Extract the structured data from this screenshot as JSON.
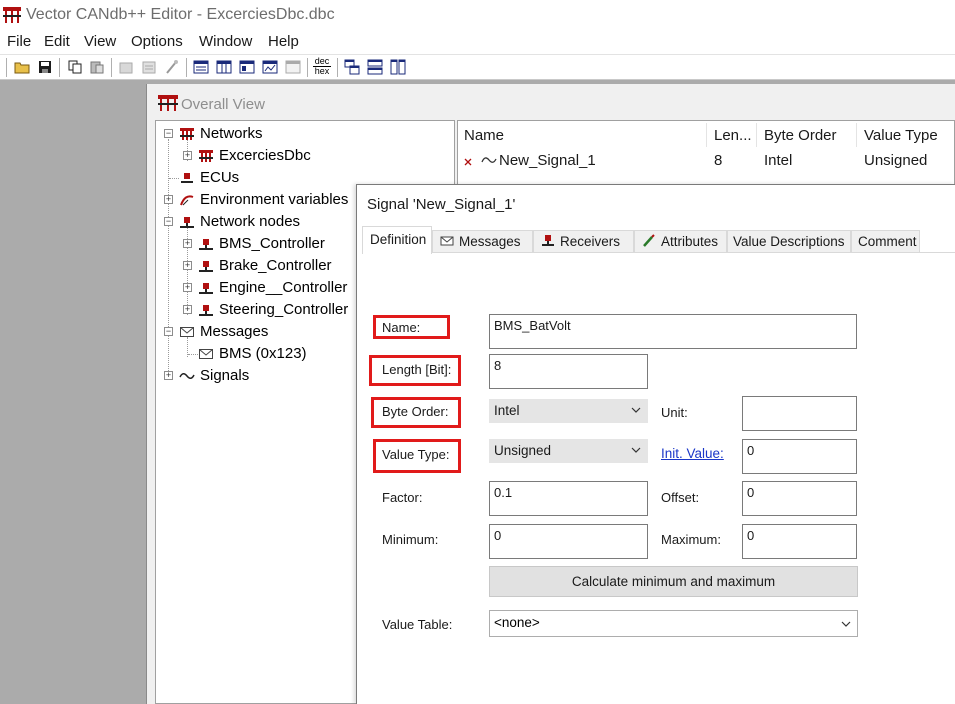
{
  "app": {
    "title": "Vector CANdb++ Editor - ExcerciesDbc.dbc"
  },
  "menu": [
    "File",
    "Edit",
    "View",
    "Options",
    "Window",
    "Help"
  ],
  "toolbar": {
    "dec_hex_top": "dec",
    "dec_hex_bottom": "hex"
  },
  "overall_view": {
    "title": "Overall View",
    "tree": [
      {
        "label": "Networks"
      },
      {
        "label": "ExcerciesDbc"
      },
      {
        "label": "ECUs"
      },
      {
        "label": "Environment variables"
      },
      {
        "label": "Network nodes"
      },
      {
        "label": "BMS_Controller"
      },
      {
        "label": "Brake_Controller"
      },
      {
        "label": "Engine__Controller"
      },
      {
        "label": "Steering_Controller"
      },
      {
        "label": "Messages"
      },
      {
        "label": "BMS (0x123)"
      },
      {
        "label": "Signals"
      }
    ],
    "list": {
      "columns": [
        "Name",
        "Len...",
        "Byte Order",
        "Value Type"
      ],
      "row": {
        "name": "New_Signal_1",
        "length": "8",
        "byte_order": "Intel",
        "value_type": "Unsigned"
      }
    }
  },
  "signal_dialog": {
    "title": "Signal 'New_Signal_1'",
    "tabs": [
      "Definition",
      "Messages",
      "Receivers",
      "Attributes",
      "Value Descriptions",
      "Comment"
    ],
    "labels": {
      "name": "Name:",
      "length": "Length [Bit]:",
      "byte_order": "Byte Order:",
      "value_type": "Value Type:",
      "unit": "Unit:",
      "init_value": "Init. Value:",
      "factor": "Factor:",
      "offset": "Offset:",
      "minimum": "Minimum:",
      "maximum": "Maximum:",
      "value_table": "Value Table:"
    },
    "values": {
      "name": "BMS_BatVolt",
      "length": "8",
      "byte_order": "Intel",
      "value_type": "Unsigned",
      "unit": "",
      "init_value": "0",
      "factor": "0.1",
      "offset": "0",
      "minimum": "0",
      "maximum": "0",
      "value_table": "<none>"
    },
    "calc_button": "Calculate minimum and maximum",
    "highlight_color": "#e11a1a"
  }
}
